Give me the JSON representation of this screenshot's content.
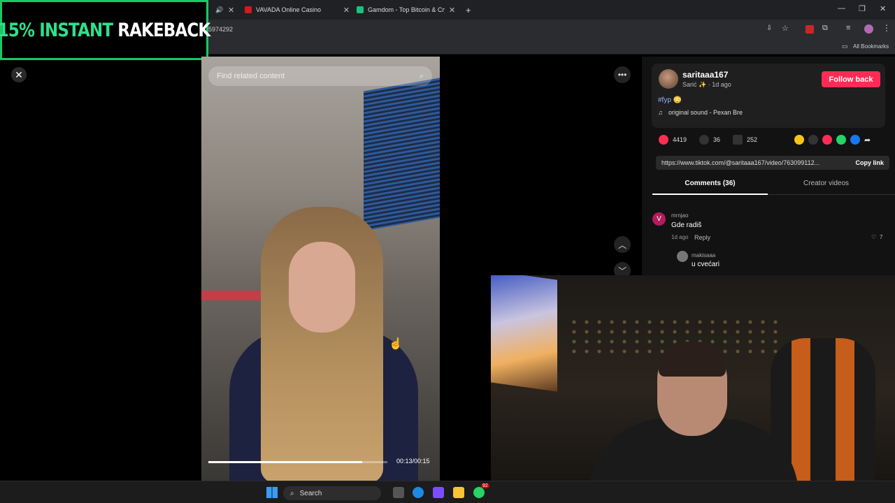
{
  "browser": {
    "tabs": [
      {
        "label": "VAVADA Online Casino",
        "favicon_color": "#d11a1a"
      },
      {
        "label": "Gamdom - Top Bitcoin & Crypto",
        "favicon_color": "#19c37d"
      }
    ],
    "address_fragment": "5974292",
    "bookmarks_label": "All Bookmarks"
  },
  "overlay": {
    "promo_green": "15% INSTANT",
    "promo_white": "RAKEBACK"
  },
  "video": {
    "search_placeholder": "Find related content",
    "time": "00:13/00:15",
    "progress": 0.86
  },
  "post": {
    "username": "saritaaa167",
    "subline": "Sarić ✨ · 1d ago",
    "follow_label": "Follow back",
    "hashtag": "#fyp 😳",
    "sound": "original sound - Pexan Bre",
    "likes": "4419",
    "comments_count": "36",
    "saves": "252",
    "link": "https://www.tiktok.com/@saritaaa167/video/763099112...",
    "copy_label": "Copy link"
  },
  "panel_tabs": {
    "comments": "Comments (36)",
    "creator": "Creator videos"
  },
  "comments": [
    {
      "avatar_letter": "V",
      "user": "mrnjao",
      "text": "Gde radiš",
      "meta": "1d ago",
      "reply_label": "Reply",
      "likes": "7"
    },
    {
      "user": "makisaaa",
      "text": "u cvećari"
    }
  ],
  "taskbar": {
    "search_label": "Search",
    "whatsapp_badge": "92"
  },
  "colors": {
    "accent_pink": "#fe2c55",
    "promo_border": "#18c964",
    "panel_bg": "#121212"
  }
}
